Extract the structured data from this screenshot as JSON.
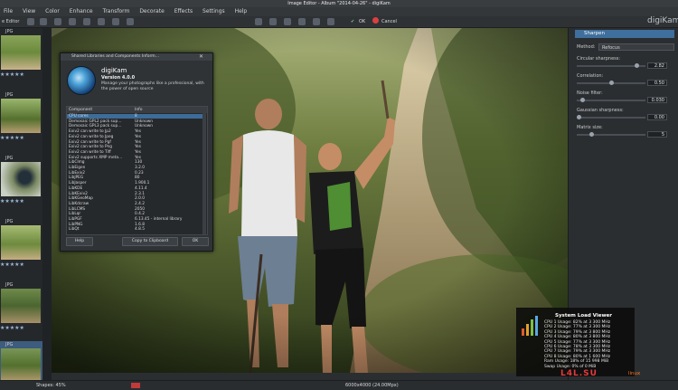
{
  "window": {
    "title": "Image Editor - Album \"2014-04-26\" - digiKam"
  },
  "menubar": {
    "items": [
      "File",
      "View",
      "Color",
      "Enhance",
      "Transform",
      "Decorate",
      "Effects",
      "Settings",
      "Help"
    ]
  },
  "toolbar": {
    "left_label": "e Editor",
    "ok_label": "OK",
    "cancel_label": "Cancel",
    "brand": "digiKam"
  },
  "thumbnails": [
    {
      "tag": "JPG",
      "stars": "★★★★★"
    },
    {
      "tag": "JPG",
      "stars": "★★★★★"
    },
    {
      "tag": "JPG",
      "stars": "★★★★★"
    },
    {
      "tag": "JPG",
      "stars": "★★★★★"
    },
    {
      "tag": "JPG",
      "stars": "★★★★★"
    },
    {
      "tag": "JPG",
      "stars": "★★★★★"
    },
    {
      "tag": "JPG",
      "stars": ""
    }
  ],
  "about": {
    "window_title": "Shared Libraries and Components Inform…",
    "app_name": "digiKam",
    "version": "Version 4.0.0",
    "description": "Manage your photographs like a professional, with the power of open source",
    "col_component": "Component",
    "col_info": "Info",
    "rows": [
      [
        "CPU cores",
        "8"
      ],
      [
        "Demosaic GPL2 pack sup…",
        "Unknown"
      ],
      [
        "Demosaic GPL3 pack sup…",
        "Unknown"
      ],
      [
        "Exiv2 can write to Jp2",
        "Yes"
      ],
      [
        "Exiv2 can write to Jpeg",
        "Yes"
      ],
      [
        "Exiv2 can write to Pgf",
        "Yes"
      ],
      [
        "Exiv2 can write to Png",
        "Yes"
      ],
      [
        "Exiv2 can write to Tiff",
        "Yes"
      ],
      [
        "Exiv2 supports XMP meta…",
        "Yes"
      ],
      [
        "LibCImg",
        "130"
      ],
      [
        "LibEigen",
        "3.2.0"
      ],
      [
        "LibExiv2",
        "0.23"
      ],
      [
        "LibJPEG",
        "80"
      ],
      [
        "LibJasper",
        "1.900.1"
      ],
      [
        "LibKDE",
        "4.11.4"
      ],
      [
        "LibKExiv2",
        "2.3.1"
      ],
      [
        "LibKGeoMap",
        "2.0.0"
      ],
      [
        "LibKdcraw",
        "2.4.2"
      ],
      [
        "LibLCMS",
        "2050"
      ],
      [
        "LibLqr",
        "0.4.2"
      ],
      [
        "LibPGF",
        "6.13.45 - internal library"
      ],
      [
        "LibPNG",
        "1.6.8"
      ],
      [
        "LibQt",
        "4.8.5"
      ]
    ],
    "help_label": "Help",
    "copy_label": "Copy to Clipboard",
    "ok_label": "OK"
  },
  "panel": {
    "title": "Sharpen",
    "method_label": "Method:",
    "method_value": "Refocus",
    "params": [
      {
        "label": "Circular sharpness:",
        "value": "2.82",
        "level": 0.9
      },
      {
        "label": "Correlation:",
        "value": "0.50",
        "level": 0.5
      },
      {
        "label": "Noise filter:",
        "value": "0.030",
        "level": 0.05
      },
      {
        "label": "Gaussian sharpness:",
        "value": "0.00",
        "level": 0.0
      },
      {
        "label": "Matrix size:",
        "value": "5",
        "level": 0.2
      }
    ]
  },
  "statusbar": {
    "zoom": "Shapes: 45%",
    "info": "6000x4000 (24.00Mpx)"
  },
  "load_viewer": {
    "title": "System Load Viewer",
    "lines": [
      "CPU 1 Usage: 82% at 3 300 MHz",
      "CPU 2 Usage: 77% at 3 300 MHz",
      "CPU 3 Usage: 79% at 3 800 MHz",
      "CPU 4 Usage: 80% at 3 800 MHz",
      "CPU 5 Usage: 77% at 3 300 MHz",
      "CPU 6 Usage: 78% at 3 300 MHz",
      "CPU 7 Usage: 79% at 3 300 MHz",
      "CPU 8 Usage: 80% at 1 600 MHz",
      "Ram Usage: 18% of 15 998 MiB",
      "Swap Usage: 0% of 0 MiB"
    ]
  },
  "watermark": {
    "text": "L4L.SU",
    "subtext": "linux"
  }
}
